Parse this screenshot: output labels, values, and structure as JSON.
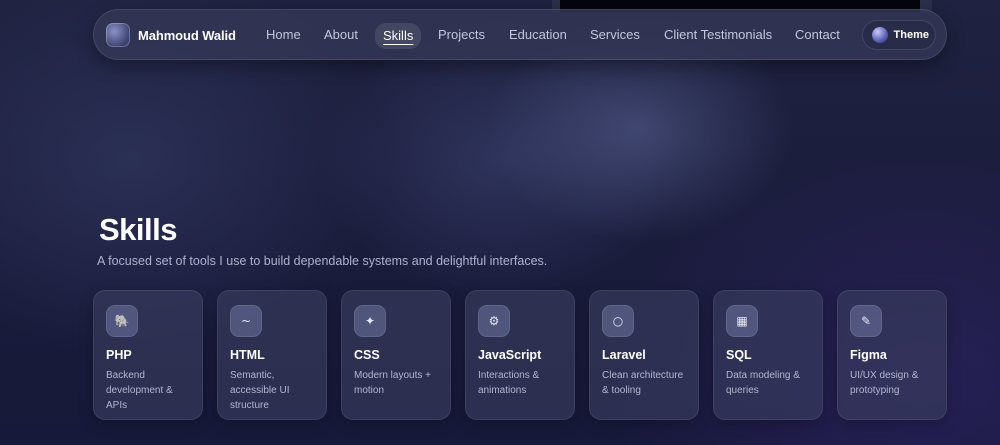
{
  "brand": {
    "name": "Mahmoud Walid",
    "avatar_icon": "avatar-logo-icon"
  },
  "nav": {
    "links": [
      {
        "label": "Home"
      },
      {
        "label": "About"
      },
      {
        "label": "Skills",
        "active": true
      },
      {
        "label": "Projects"
      },
      {
        "label": "Education"
      },
      {
        "label": "Services"
      },
      {
        "label": "Client Testimonials"
      },
      {
        "label": "Contact"
      }
    ],
    "theme_label": "Theme"
  },
  "skills": {
    "title": "Skills",
    "subtitle": "A focused set of tools I use to build dependable systems and delightful interfaces.",
    "cards": [
      {
        "icon": "🐘",
        "icon_name": "elephant-icon",
        "title": "PHP",
        "desc": "Backend development & APIs"
      },
      {
        "icon": "~",
        "icon_name": "tilde-icon",
        "title": "HTML",
        "desc": "Semantic, accessible UI structure"
      },
      {
        "icon": "✦",
        "icon_name": "sparkle-icon",
        "title": "CSS",
        "desc": "Modern layouts + motion"
      },
      {
        "icon": "⚙",
        "icon_name": "gear-icon",
        "title": "JavaScript",
        "desc": "Interactions & animations"
      },
      {
        "icon": "○",
        "icon_name": "circle-icon",
        "title": "Laravel",
        "desc": "Clean architecture & tooling"
      },
      {
        "icon": "▦",
        "icon_name": "grid-icon",
        "title": "SQL",
        "desc": "Data modeling & queries"
      },
      {
        "icon": "✎",
        "icon_name": "pen-icon",
        "title": "Figma",
        "desc": "UI/UX design & prototyping"
      }
    ]
  },
  "colors": {
    "background": "#1b1d3c",
    "navbar": "#343856",
    "text_primary": "#ffffff",
    "text_muted": "#aeb2cc"
  }
}
